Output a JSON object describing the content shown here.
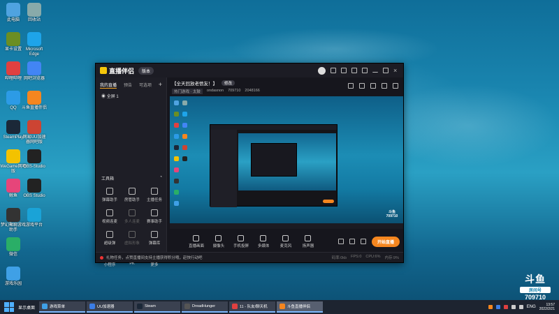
{
  "desktop": {
    "icons_left": [
      {
        "label": "此电脑",
        "color": "#4fa3e0"
      },
      {
        "label": "显卡设置",
        "color": "#6b8e23"
      },
      {
        "label": "哔哩哔哩",
        "color": "#e04040"
      },
      {
        "label": "QQ",
        "color": "#2c9be6"
      },
      {
        "label": "SteamPlay",
        "color": "#1b2838"
      },
      {
        "label": "WeGame网吧版",
        "color": "#f3c200"
      },
      {
        "label": "鲸鱼",
        "color": "#e6457a"
      },
      {
        "label": "梦幻聚聊游戏助手",
        "color": "#333"
      },
      {
        "label": "微信",
        "color": "#2aae67"
      },
      {
        "label": "游戏乐园",
        "color": "#3fa0e6"
      }
    ],
    "icons_right": [
      {
        "label": "回收站",
        "color": "#8aa"
      },
      {
        "label": "Microsoft Edge",
        "color": "#1ea4e9"
      },
      {
        "label": "网吧浏览器",
        "color": "#4285f4"
      },
      {
        "label": "斗鱼直播伴侣",
        "color": "#f5861f"
      },
      {
        "label": "网易UU加速器网吧版",
        "color": "#c43"
      },
      {
        "label": "OBS-Studio",
        "color": "#222"
      },
      {
        "label": "OBS Studio",
        "color": "#222"
      },
      {
        "label": "游戏平台",
        "color": "#1aa3d7"
      }
    ]
  },
  "app": {
    "logo": "直播伴侣",
    "version": "版本",
    "sidebar_tabs": [
      "我的直播",
      "预告",
      "可选项"
    ],
    "scene_item": "全屏 1",
    "tools_label": "工具箱",
    "tools": [
      {
        "label": "弹幕助手",
        "dim": false
      },
      {
        "label": "房管助手",
        "dim": false
      },
      {
        "label": "主播任务",
        "dim": false
      },
      {
        "label": "视频连麦",
        "dim": false
      },
      {
        "label": "多人连麦",
        "dim": true
      },
      {
        "label": "赛事助手",
        "dim": false
      },
      {
        "label": "超级弹",
        "dim": false
      },
      {
        "label": "虚拟形象",
        "dim": true
      },
      {
        "label": "弹幕库",
        "dim": false
      },
      {
        "label": "小程序",
        "dim": false
      },
      {
        "label": "PK",
        "dim": false
      },
      {
        "label": "更多",
        "dim": false
      }
    ],
    "room_title": "【全天回放老愤友！】",
    "room_tag": "修改",
    "room_category": "热门游戏 · 太鼓",
    "room_user": "ondasnon",
    "room_id": "709710",
    "room_hot": "2048166",
    "bottom_tools": [
      "直播画面",
      "摄像头",
      "手机投屏",
      "多媒体",
      "麦克风",
      "扬声器"
    ],
    "start_button": "开始直播",
    "status_text": "礼物任务，点赞直播间支持主播获得积分哦，赶快行动吧",
    "stats": [
      "码率:0kb",
      "FPS:0",
      "CPU:6%",
      "内存:9%"
    ]
  },
  "watermark": {
    "brand": "斗鱼",
    "sub": "房间号",
    "room": "709710"
  },
  "taskbar": {
    "start_label": "显示桌面",
    "items": [
      {
        "label": "游戏菜单",
        "color": "#3fa0e6",
        "active": false
      },
      {
        "label": "UU加速器",
        "color": "#3b7de6",
        "active": false
      },
      {
        "label": "Steam",
        "color": "#1b2838",
        "active": false
      },
      {
        "label": "DreadHunger",
        "color": "#555",
        "active": false
      },
      {
        "label": "11 - 队友/聊天机",
        "color": "#e04040",
        "active": false
      },
      {
        "label": "斗鱼直播伴侣",
        "color": "#f5861f",
        "active": true
      }
    ],
    "tray_lang": "ENG",
    "time": "13:57",
    "date": "2022/2/21"
  }
}
